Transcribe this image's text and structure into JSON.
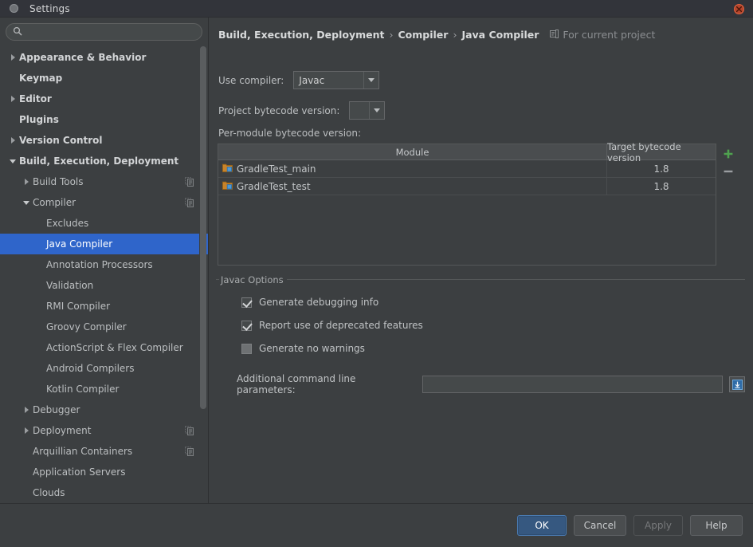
{
  "window": {
    "title": "Settings",
    "close_label": "close",
    "icon": "window-menu-dot"
  },
  "search": {
    "value": "",
    "placeholder": "",
    "icon": "search-icon"
  },
  "sidebar": {
    "items": [
      {
        "label": "Appearance & Behavior",
        "arrow": "right",
        "indent": 0,
        "bold": true,
        "selected": false,
        "copy": false
      },
      {
        "label": "Keymap",
        "arrow": "none",
        "indent": 0,
        "bold": true,
        "selected": false,
        "copy": false
      },
      {
        "label": "Editor",
        "arrow": "right",
        "indent": 0,
        "bold": true,
        "selected": false,
        "copy": false
      },
      {
        "label": "Plugins",
        "arrow": "none",
        "indent": 0,
        "bold": true,
        "selected": false,
        "copy": false
      },
      {
        "label": "Version Control",
        "arrow": "right",
        "indent": 0,
        "bold": true,
        "selected": false,
        "copy": false
      },
      {
        "label": "Build, Execution, Deployment",
        "arrow": "down",
        "indent": 0,
        "bold": true,
        "selected": false,
        "copy": false
      },
      {
        "label": "Build Tools",
        "arrow": "right",
        "indent": 1,
        "bold": false,
        "selected": false,
        "copy": true
      },
      {
        "label": "Compiler",
        "arrow": "down",
        "indent": 1,
        "bold": false,
        "selected": false,
        "copy": true
      },
      {
        "label": "Excludes",
        "arrow": "none",
        "indent": 2,
        "bold": false,
        "selected": false,
        "copy": false
      },
      {
        "label": "Java Compiler",
        "arrow": "none",
        "indent": 2,
        "bold": false,
        "selected": true,
        "copy": false
      },
      {
        "label": "Annotation Processors",
        "arrow": "none",
        "indent": 2,
        "bold": false,
        "selected": false,
        "copy": false
      },
      {
        "label": "Validation",
        "arrow": "none",
        "indent": 2,
        "bold": false,
        "selected": false,
        "copy": false
      },
      {
        "label": "RMI Compiler",
        "arrow": "none",
        "indent": 2,
        "bold": false,
        "selected": false,
        "copy": false
      },
      {
        "label": "Groovy Compiler",
        "arrow": "none",
        "indent": 2,
        "bold": false,
        "selected": false,
        "copy": false
      },
      {
        "label": "ActionScript & Flex Compiler",
        "arrow": "none",
        "indent": 2,
        "bold": false,
        "selected": false,
        "copy": false
      },
      {
        "label": "Android Compilers",
        "arrow": "none",
        "indent": 2,
        "bold": false,
        "selected": false,
        "copy": false
      },
      {
        "label": "Kotlin Compiler",
        "arrow": "none",
        "indent": 2,
        "bold": false,
        "selected": false,
        "copy": false
      },
      {
        "label": "Debugger",
        "arrow": "right",
        "indent": 1,
        "bold": false,
        "selected": false,
        "copy": false
      },
      {
        "label": "Deployment",
        "arrow": "right",
        "indent": 1,
        "bold": false,
        "selected": false,
        "copy": true
      },
      {
        "label": "Arquillian Containers",
        "arrow": "none",
        "indent": 1,
        "bold": false,
        "selected": false,
        "copy": true
      },
      {
        "label": "Application Servers",
        "arrow": "none",
        "indent": 1,
        "bold": false,
        "selected": false,
        "copy": false
      },
      {
        "label": "Clouds",
        "arrow": "none",
        "indent": 1,
        "bold": false,
        "selected": false,
        "copy": false
      }
    ]
  },
  "breadcrumb": {
    "parts": [
      "Build, Execution, Deployment",
      "Compiler",
      "Java Compiler"
    ],
    "separator": "›",
    "scope_label": "For current project",
    "scope_icon": "project-scope-icon"
  },
  "form": {
    "use_compiler_label": "Use compiler:",
    "use_compiler_value": "Javac",
    "project_bytecode_label": "Project bytecode version:",
    "project_bytecode_value": "",
    "per_module_label": "Per-module bytecode version:"
  },
  "table": {
    "columns": [
      "Module",
      "Target bytecode version"
    ],
    "rows": [
      {
        "module": "GradleTest_main",
        "target": "1.8",
        "icon": "module-icon"
      },
      {
        "module": "GradleTest_test",
        "target": "1.8",
        "icon": "module-icon"
      }
    ],
    "add_label": "+",
    "remove_label": "−",
    "add_icon": "plus-icon",
    "remove_icon": "minus-icon"
  },
  "javac_options": {
    "title": "Javac Options",
    "checkboxes": [
      {
        "label": "Generate debugging info",
        "checked": true
      },
      {
        "label": "Report use of deprecated features",
        "checked": true
      },
      {
        "label": "Generate no warnings",
        "checked": false
      }
    ],
    "params_label": "Additional command line parameters:",
    "params_value": "",
    "expand_icon": "expand-field-icon"
  },
  "buttons": {
    "ok": "OK",
    "cancel": "Cancel",
    "apply": "Apply",
    "help": "Help"
  },
  "annotation": {
    "shape": "ellipse",
    "color": "#e01b1b",
    "target": "Target bytecode version values"
  },
  "colors": {
    "background": "#3c3f41",
    "titlebar": "#32343a",
    "selection": "#2f65ca",
    "primary_button": "#365880",
    "accent_add": "#4fa14f",
    "annotation": "#e01b1b"
  }
}
